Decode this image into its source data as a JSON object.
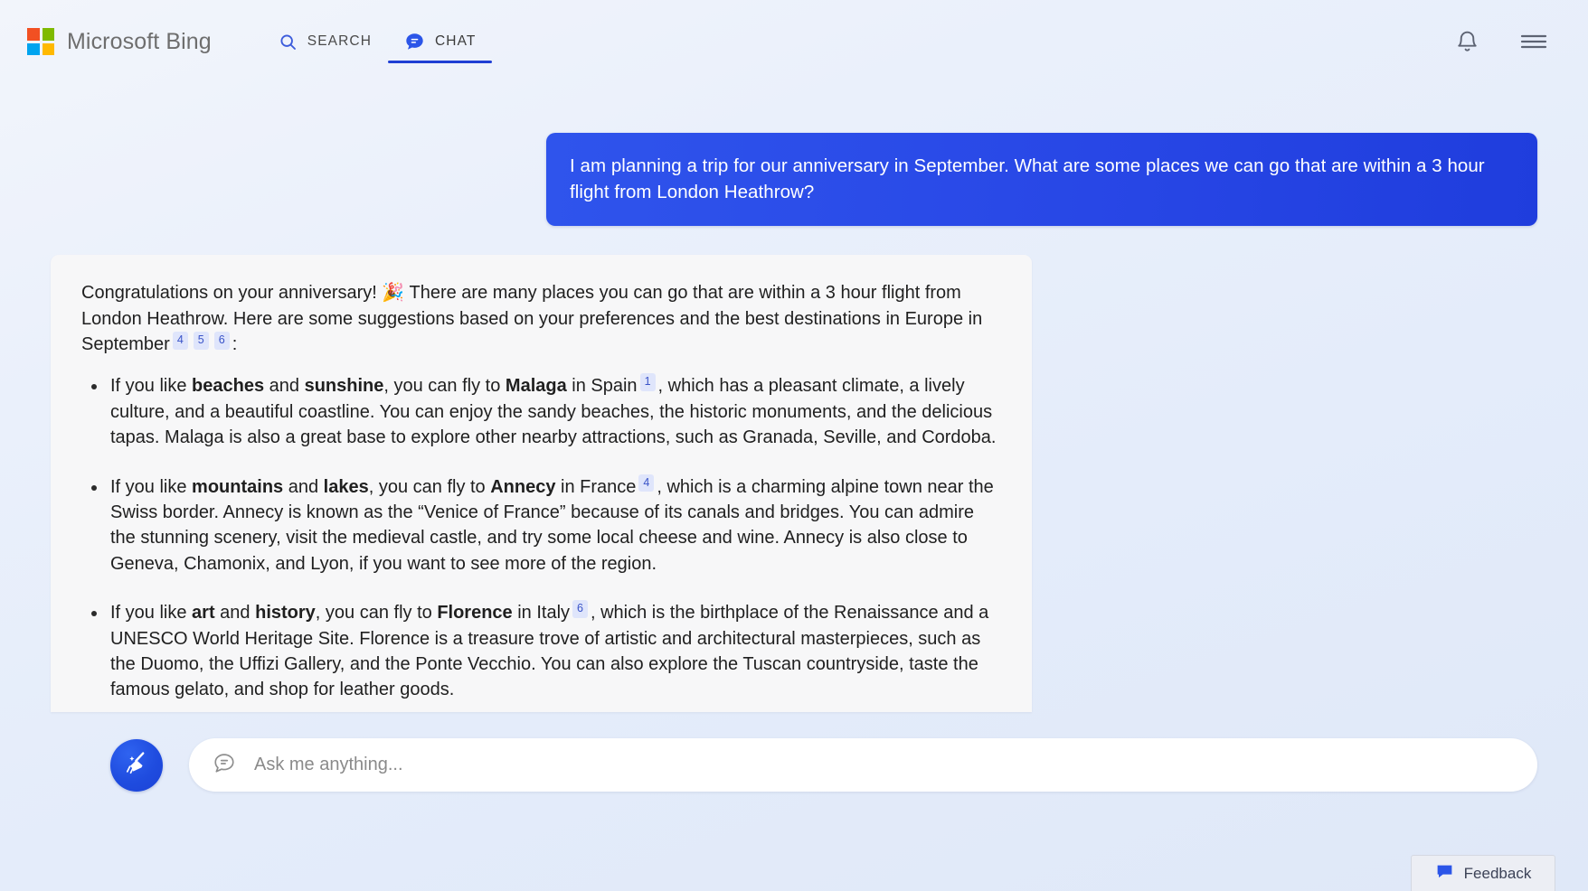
{
  "header": {
    "brand_name": "Microsoft Bing",
    "logo_colors": [
      "#f25022",
      "#7fba00",
      "#00a4ef",
      "#ffb900"
    ],
    "tabs": [
      {
        "id": "search",
        "label": "SEARCH",
        "icon": "search-icon",
        "active": false
      },
      {
        "id": "chat",
        "label": "CHAT",
        "icon": "chat-bubble-icon",
        "active": true
      }
    ],
    "right_icons": [
      {
        "id": "notifications",
        "icon": "bell-icon"
      },
      {
        "id": "menu",
        "icon": "hamburger-menu-icon"
      }
    ],
    "accent_color": "#1f3fd4"
  },
  "conversation": {
    "user_message": "I am planning a trip for our anniversary in September. What are some places we can go that are within a 3 hour flight from London Heathrow?",
    "user_bubble_color": "#2847e6",
    "answer": {
      "intro": {
        "text_before": "Congratulations on your anniversary! ",
        "emoji": "🎉",
        "text_middle": " There are many places you can go that are within a 3 hour flight from London Heathrow. Here are some suggestions based on your preferences and the best destinations in Europe in September",
        "citations": [
          "4",
          "5",
          "6"
        ],
        "text_after": ":"
      },
      "bullets": [
        {
          "lead": "If you like ",
          "bold1": "beaches",
          "mid1": " and ",
          "bold2": "sunshine",
          "mid2": ", you can fly to ",
          "bold3": "Malaga",
          "mid3": " in Spain",
          "citation": "1",
          "rest": ", which has a pleasant climate, a lively culture, and a beautiful coastline. You can enjoy the sandy beaches, the historic monuments, and the delicious tapas. Malaga is also a great base to explore other nearby attractions, such as Granada, Seville, and Cordoba."
        },
        {
          "lead": "If you like ",
          "bold1": "mountains",
          "mid1": " and ",
          "bold2": "lakes",
          "mid2": ", you can fly to ",
          "bold3": "Annecy",
          "mid3": " in France",
          "citation": "4",
          "rest": ", which is a charming alpine town near the Swiss border. Annecy is known as the “Venice of France” because of its canals and bridges. You can admire the stunning scenery, visit the medieval castle, and try some local cheese and wine. Annecy is also close to Geneva, Chamonix, and Lyon, if you want to see more of the region."
        },
        {
          "lead": "If you like ",
          "bold1": "art",
          "mid1": " and ",
          "bold2": "history",
          "mid2": ", you can fly to ",
          "bold3": "Florence",
          "mid3": " in Italy",
          "citation": "6",
          "rest": ", which is the birthplace of the Renaissance and a UNESCO World Heritage Site. Florence is a treasure trove of artistic and architectural masterpieces, such as the Duomo, the Uffizi Gallery, and the Ponte Vecchio. You can also explore the Tuscan countryside, taste the famous gelato, and shop for leather goods."
        }
      ]
    }
  },
  "composer": {
    "new_topic_icon": "broom-icon",
    "input_icon": "chat-bubble-outline-icon",
    "placeholder": "Ask me anything...",
    "value": ""
  },
  "feedback": {
    "label": "Feedback",
    "icon": "feedback-bubble-icon"
  }
}
